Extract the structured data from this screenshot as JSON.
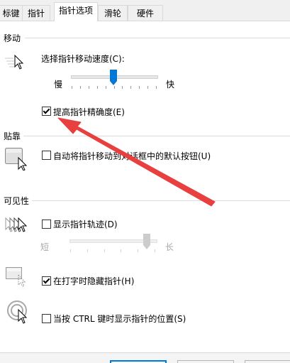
{
  "tabs": [
    {
      "label": "标键",
      "active": false
    },
    {
      "label": "指针",
      "active": false
    },
    {
      "label": "指针选项",
      "active": true
    },
    {
      "label": "滑轮",
      "active": false
    },
    {
      "label": "硬件",
      "active": false
    }
  ],
  "motion": {
    "section_label": "移动",
    "speed_label": "选择指针移动速度(C):",
    "slow_label": "慢",
    "fast_label": "快",
    "speed_level": 0.5,
    "precision_label": "提高指针精确度(E)",
    "precision_checked": true
  },
  "snap": {
    "section_label": "贴靠",
    "snap_label": "自动将指针移动到对话框中的默认按钮(U)",
    "snap_checked": false
  },
  "visibility": {
    "section_label": "可见性",
    "trails_label": "显示指针轨迹(D)",
    "trails_checked": false,
    "short_label": "短",
    "long_label": "长",
    "trails_level": 1.0,
    "hide_label": "在打字时隐藏指针(H)",
    "hide_checked": true,
    "ctrl_label": "当按 CTRL 键时显示指针的位置(S)",
    "ctrl_checked": false
  },
  "annotation": {
    "arrow_color": "#e8403f"
  },
  "colors": {
    "accent": "#0078d7"
  }
}
